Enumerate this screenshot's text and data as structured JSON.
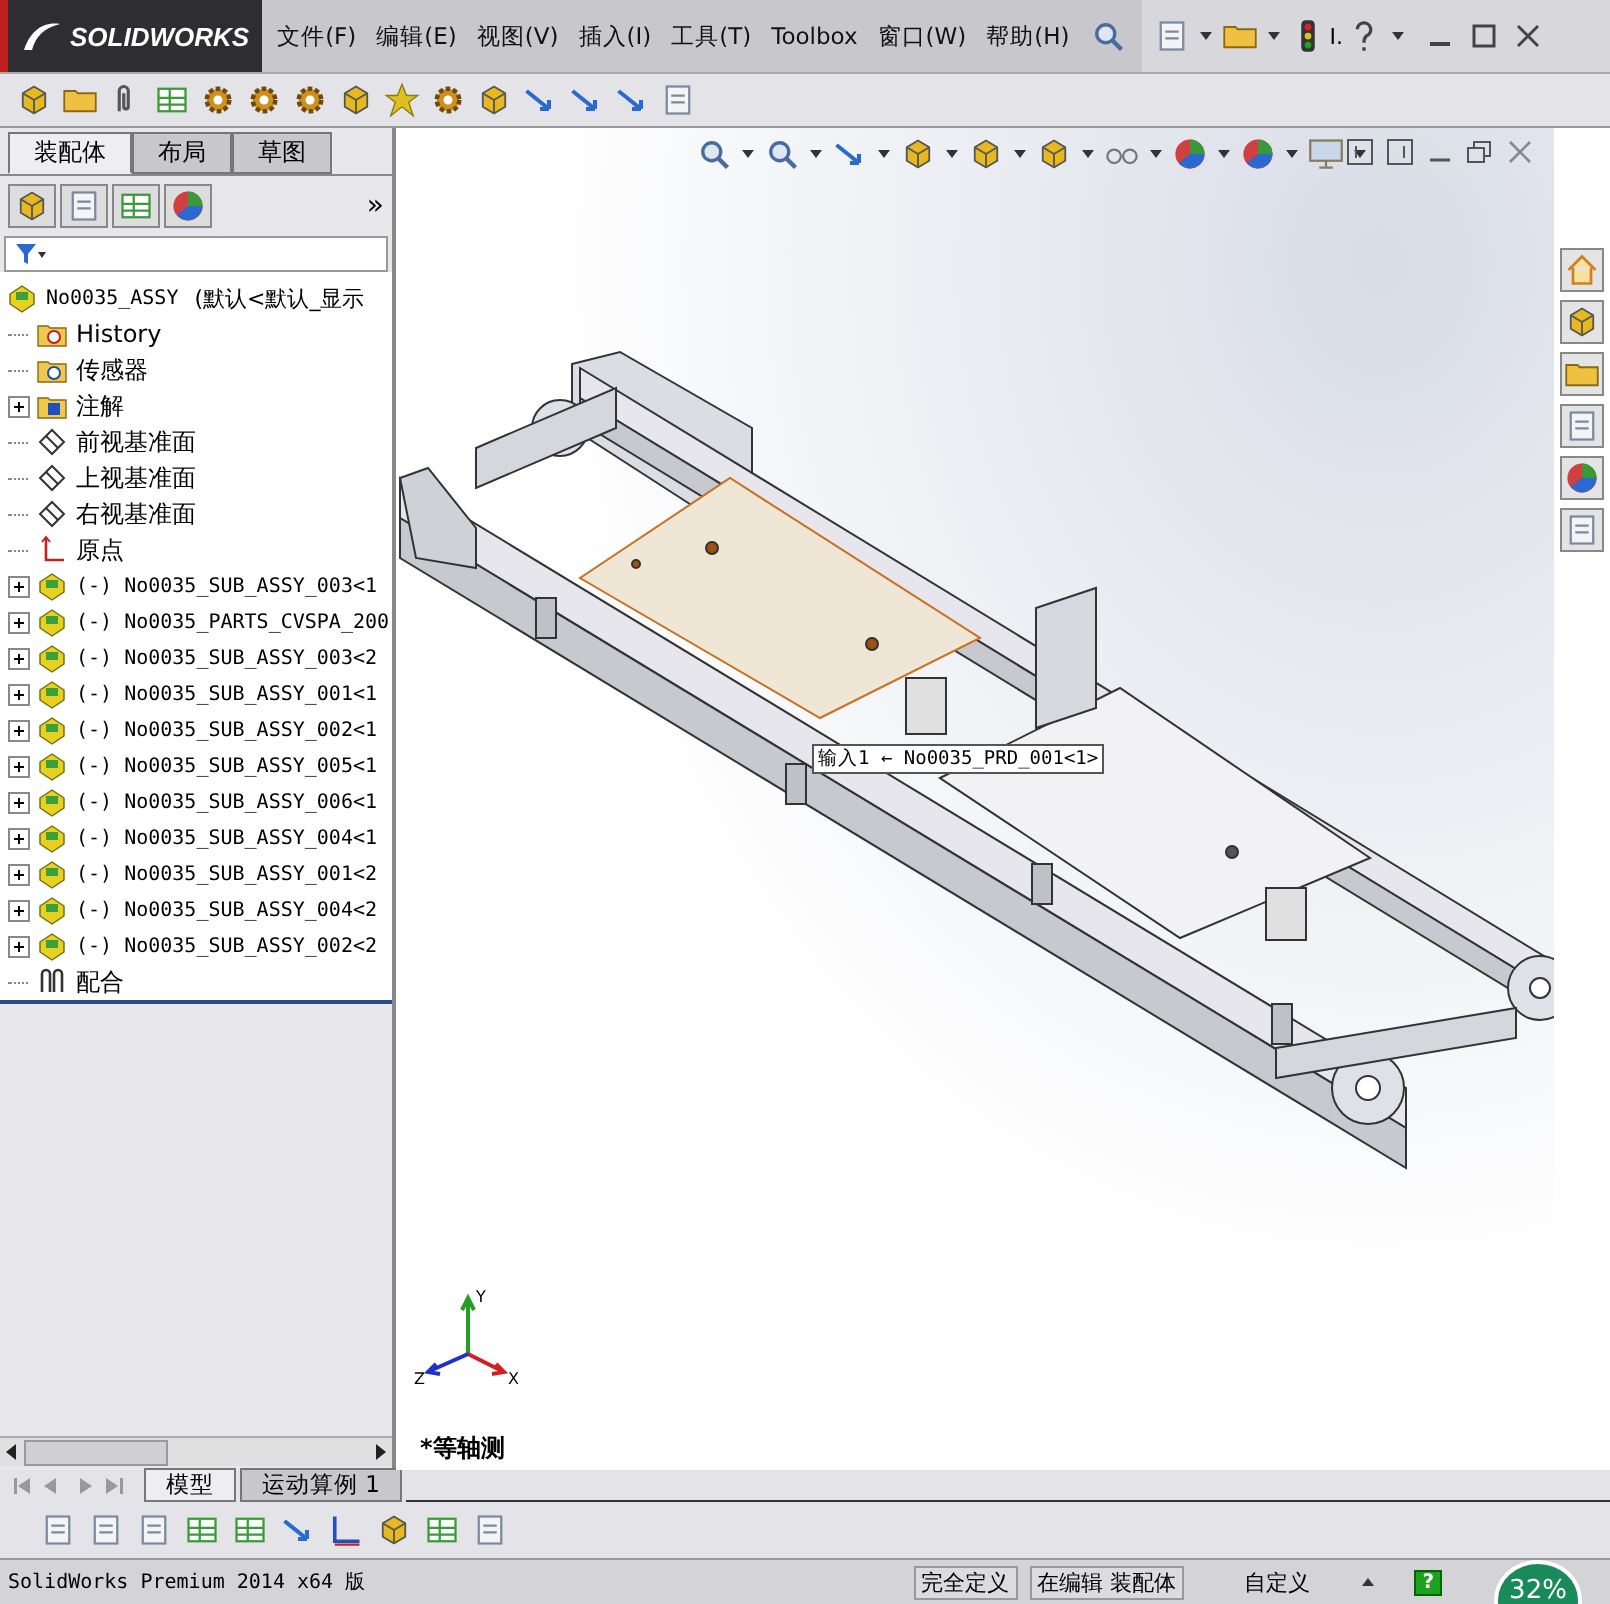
{
  "app": {
    "logo": "SOLIDWORKS",
    "menu": [
      "文件(F)",
      "编辑(E)",
      "视图(V)",
      "插入(I)",
      "工具(T)",
      "Toolbox",
      "窗口(W)",
      "帮助(H)"
    ],
    "help_text": "I."
  },
  "panel_tabs": [
    {
      "label": "装配体",
      "selected": true
    },
    {
      "label": "布局",
      "selected": false
    },
    {
      "label": "草图",
      "selected": false
    }
  ],
  "panel_more": "»",
  "tree": {
    "label": "No0035_ASSY",
    "config": "(默认<默认_显示",
    "kind": "assembly",
    "children": [
      {
        "label": "History",
        "kind": "history",
        "collapsed": false
      },
      {
        "label": "传感器",
        "kind": "sensor",
        "collapsed": false
      },
      {
        "label": "注解",
        "kind": "annotation",
        "collapsed": true
      },
      {
        "label": "前视基准面",
        "kind": "plane",
        "collapsed": false
      },
      {
        "label": "上视基准面",
        "kind": "plane",
        "collapsed": false
      },
      {
        "label": "右视基准面",
        "kind": "plane",
        "collapsed": false
      },
      {
        "label": "原点",
        "kind": "origin",
        "collapsed": false
      },
      {
        "label": "(-) No0035_SUB_ASSY_003<1",
        "kind": "assembly",
        "collapsed": true
      },
      {
        "label": "(-) No0035_PARTS_CVSPA_200",
        "kind": "assembly",
        "collapsed": true
      },
      {
        "label": "(-) No0035_SUB_ASSY_003<2",
        "kind": "assembly",
        "collapsed": true
      },
      {
        "label": "(-) No0035_SUB_ASSY_001<1",
        "kind": "assembly",
        "collapsed": true
      },
      {
        "label": "(-) No0035_SUB_ASSY_002<1",
        "kind": "assembly",
        "collapsed": true
      },
      {
        "label": "(-) No0035_SUB_ASSY_005<1",
        "kind": "assembly",
        "collapsed": true
      },
      {
        "label": "(-) No0035_SUB_ASSY_006<1",
        "kind": "assembly",
        "collapsed": true
      },
      {
        "label": "(-) No0035_SUB_ASSY_004<1",
        "kind": "assembly",
        "collapsed": true
      },
      {
        "label": "(-) No0035_SUB_ASSY_001<2",
        "kind": "assembly",
        "collapsed": true
      },
      {
        "label": "(-) No0035_SUB_ASSY_004<2",
        "kind": "assembly",
        "collapsed": true
      },
      {
        "label": "(-) No0035_SUB_ASSY_002<2",
        "kind": "assembly",
        "collapsed": true
      },
      {
        "label": "配合",
        "kind": "mates",
        "collapsed": false
      }
    ]
  },
  "viewport": {
    "callout": "输入1 ← No0035_PRD_001<1>",
    "view_name": "*等轴测",
    "triad": [
      "Y",
      "Z",
      "X"
    ]
  },
  "bottom_tabs": [
    {
      "label": "模型",
      "selected": true
    },
    {
      "label": "运动算例 1",
      "selected": false
    }
  ],
  "status_bar": {
    "product": "SolidWorks Premium 2014 x64 版",
    "state": "完全定义",
    "mode": "在编辑 装配体",
    "units": "自定义",
    "help": "?",
    "progress": "32%"
  }
}
